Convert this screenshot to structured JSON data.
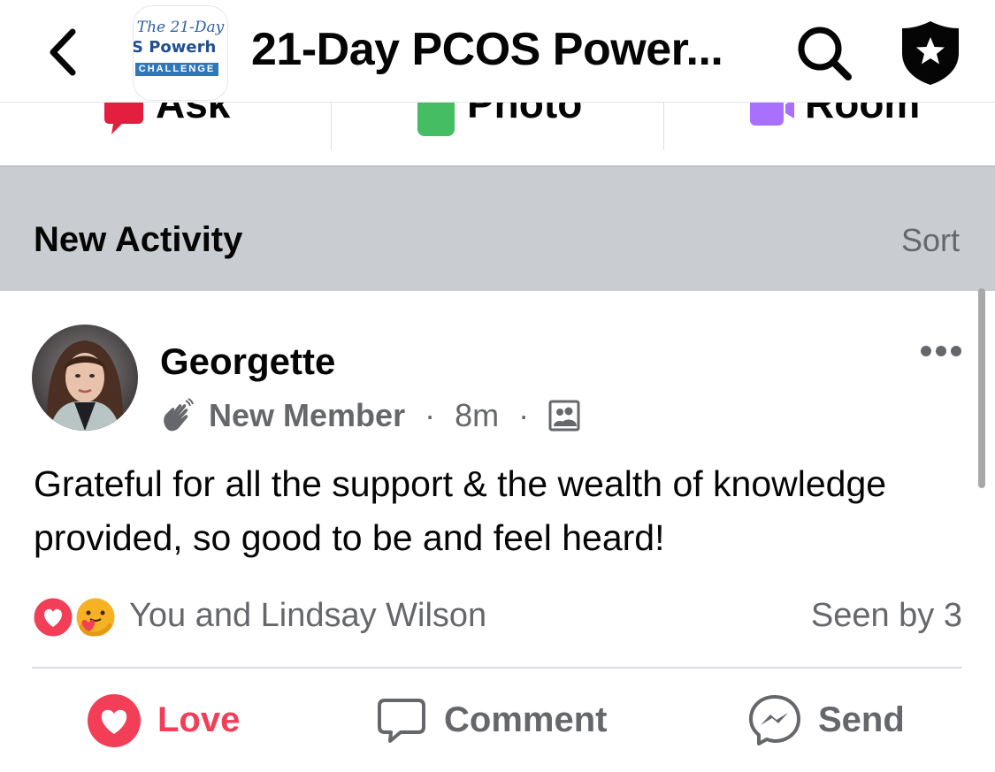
{
  "header": {
    "back_icon": "chevron-left-icon",
    "logo": {
      "line1": "The 21-Day",
      "line2": "S Powerh",
      "line3": "CHALLENGE"
    },
    "title": "21-Day PCOS Power...",
    "search_icon": "search-icon",
    "admin_icon": "shield-star-icon"
  },
  "composer": {
    "items": [
      {
        "label": "Ask",
        "icon": "chat-bubble-icon",
        "color": "#e41e3f"
      },
      {
        "label": "Photo",
        "icon": "photo-icon",
        "color": "#45bd62"
      },
      {
        "label": "Room",
        "icon": "video-room-icon",
        "color": "#a970ff"
      }
    ]
  },
  "activity": {
    "title": "New Activity",
    "sort_label": "Sort"
  },
  "post": {
    "author": "Georgette",
    "badge_icon": "waving-hand-icon",
    "badge": "New Member",
    "sep1": "·",
    "time": "8m",
    "sep2": "·",
    "audience_icon": "group-audience-icon",
    "text": "Grateful for all the support & the wealth of knowledge provided, so good to be and feel heard!",
    "reaction_icons": [
      "love-reaction-icon",
      "care-reaction-icon"
    ],
    "reactors": "You and Lindsay Wilson",
    "seen_by": "Seen by 3",
    "more_icon": "more-dots-icon"
  },
  "actions": {
    "love": {
      "label": "Love",
      "icon": "heart-icon",
      "color": "#f33e58"
    },
    "comment": {
      "label": "Comment",
      "icon": "comment-icon",
      "color": "#65676b"
    },
    "send": {
      "label": "Send",
      "icon": "messenger-icon",
      "color": "#65676b"
    }
  }
}
